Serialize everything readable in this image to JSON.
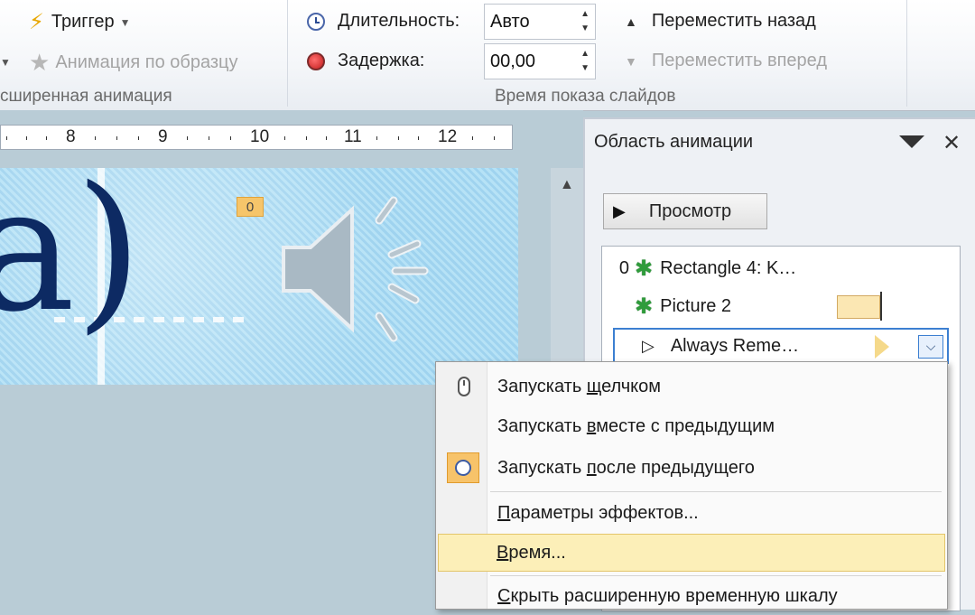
{
  "ribbon": {
    "advanced_animation": {
      "trigger_label": "Триггер",
      "painter_label": "Анимация по образцу",
      "group_label": "сширенная анимация"
    },
    "timing": {
      "duration_label": "Длительность:",
      "duration_value": "Авто",
      "delay_label": "Задержка:",
      "delay_value": "00,00",
      "group_label": "Время показа слайдов",
      "move_back_label": "Переместить назад",
      "move_forward_label": "Переместить вперед"
    }
  },
  "ruler": {
    "numbers": [
      "8",
      "9",
      "10",
      "11",
      "12"
    ]
  },
  "slide": {
    "text": "a)",
    "trigger_badge": "0"
  },
  "animation_pane": {
    "title": "Область анимации",
    "preview_label": "Просмотр",
    "items": [
      {
        "index": "0",
        "label": "Rectangle 4: K…"
      },
      {
        "index": "",
        "label": "Picture 2"
      },
      {
        "index": "",
        "label": "Always Reme…"
      }
    ]
  },
  "context_menu": {
    "items": [
      {
        "label_pre": "Запускать ",
        "label_u": "щ",
        "label_post": "елчком"
      },
      {
        "label_pre": "Запускать ",
        "label_u": "в",
        "label_post": "месте с предыдущим"
      },
      {
        "label_pre": "Запускать ",
        "label_u": "п",
        "label_post": "осле предыдущего"
      },
      {
        "label_pre": "",
        "label_u": "П",
        "label_post": "араметры эффектов..."
      },
      {
        "label_pre": "",
        "label_u": "В",
        "label_post": "ремя..."
      },
      {
        "label_pre": "",
        "label_u": "С",
        "label_post": "крыть расширенную временную шкалу"
      }
    ]
  },
  "colors": {
    "accent_selection": "#3c7fd1",
    "menu_hover": "#fcefb8",
    "timeline_bar": "#fbe7b3",
    "slide_text": "#0d2a63"
  }
}
